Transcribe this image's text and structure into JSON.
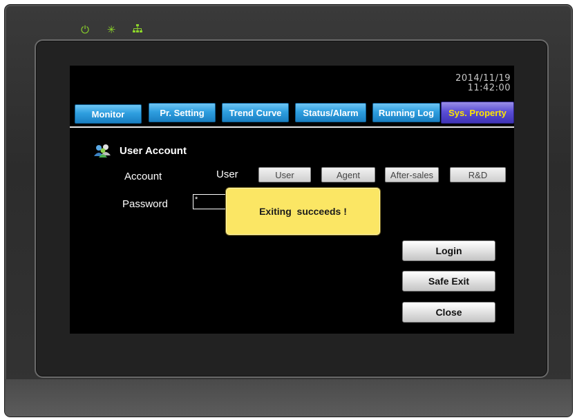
{
  "status_indicators": {
    "power_icon": "power-icon",
    "sun_icon": "sun-icon",
    "network_icon": "network-icon",
    "color": "#8cd42a"
  },
  "header": {
    "date": "2014/11/19",
    "time": "11:42:00"
  },
  "tabs": [
    {
      "label": "Monitor",
      "active": false
    },
    {
      "label": "Pr. Setting",
      "active": false
    },
    {
      "label": "Trend Curve",
      "active": false
    },
    {
      "label": "Status/Alarm",
      "active": false
    },
    {
      "label": "Running Log",
      "active": false
    },
    {
      "label": "Sys. Property",
      "active": true
    }
  ],
  "user_account": {
    "title": "User Account",
    "account_label": "Account",
    "current_account": "User",
    "account_options": [
      "User",
      "Agent",
      "After-sales",
      "R&D"
    ],
    "password_label": "Password",
    "password_value": "*"
  },
  "dialog": {
    "message": "Exiting  succeeds !"
  },
  "actions": {
    "login": "Login",
    "safe_exit": "Safe Exit",
    "close": "Close"
  },
  "colors": {
    "tab_blue": "#2f9fe0",
    "tab_active": "#5b4fd6",
    "active_text": "#ffe600",
    "dialog_bg": "#fbe664"
  }
}
